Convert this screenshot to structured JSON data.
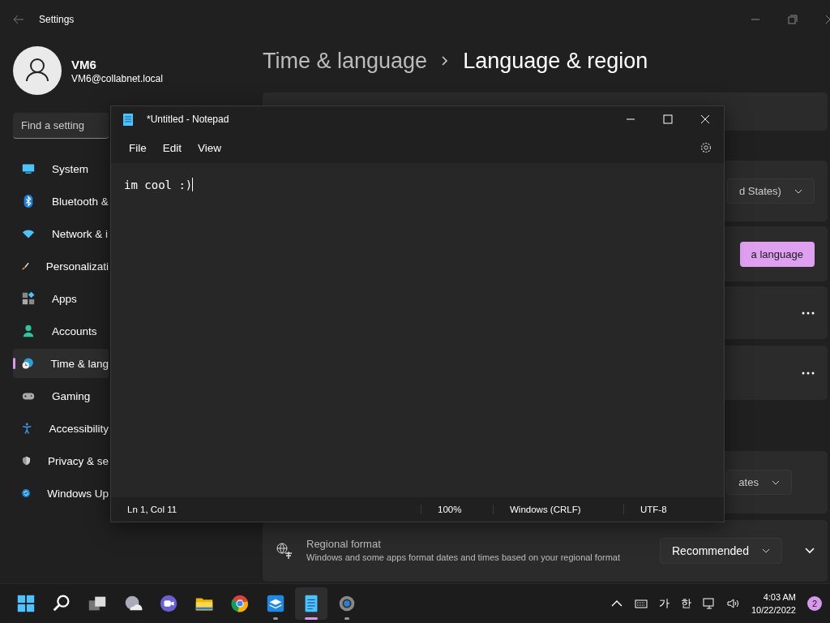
{
  "settings": {
    "title": "Settings",
    "user": {
      "name": "VM6",
      "email": "VM6@collabnet.local"
    },
    "search": {
      "placeholder": "Find a setting"
    },
    "nav": [
      {
        "label": "System",
        "selected": false
      },
      {
        "label": "Bluetooth &",
        "selected": false
      },
      {
        "label": "Network & i",
        "selected": false
      },
      {
        "label": "Personalizati",
        "selected": false
      },
      {
        "label": "Apps",
        "selected": false
      },
      {
        "label": "Accounts",
        "selected": false
      },
      {
        "label": "Time & lang",
        "selected": true
      },
      {
        "label": "Gaming",
        "selected": false
      },
      {
        "label": "Accessibility",
        "selected": false
      },
      {
        "label": "Privacy & se",
        "selected": false
      },
      {
        "label": "Windows Up",
        "selected": false
      }
    ],
    "breadcrumb": {
      "parent": "Time & language",
      "current": "Language & region"
    },
    "cards": [
      {
        "kind": "plain"
      },
      {
        "kind": "dropdown",
        "value": "d States)"
      },
      {
        "kind": "button",
        "label": "a language"
      },
      {
        "kind": "more"
      },
      {
        "kind": "more"
      },
      {
        "kind": "dropdown",
        "value": "ates"
      },
      {
        "kind": "setting",
        "title": "Regional format",
        "description": "Windows and some apps format dates and times based on your regional format",
        "value": "Recommended",
        "expanded": false
      }
    ]
  },
  "notepad": {
    "title": "*Untitled - Notepad",
    "menu": [
      "File",
      "Edit",
      "View"
    ],
    "text": "im cool :)",
    "status": [
      "Ln 1, Col 11",
      "100%",
      "Windows (CRLF)",
      "UTF-8"
    ]
  },
  "taskbar": {
    "apps": [
      {
        "selected": false,
        "running": false
      },
      {
        "selected": false,
        "running": false
      },
      {
        "selected": false,
        "running": false
      },
      {
        "selected": false,
        "running": false
      },
      {
        "selected": false,
        "running": false
      },
      {
        "selected": false,
        "running": false
      },
      {
        "selected": false,
        "running": false
      },
      {
        "selected": false,
        "running": true
      },
      {
        "selected": true,
        "running": true
      },
      {
        "selected": false,
        "running": true
      }
    ],
    "ime": [
      "가",
      "한"
    ],
    "time": "4:03 AM",
    "date": "10/22/2022",
    "notifications": "2"
  }
}
